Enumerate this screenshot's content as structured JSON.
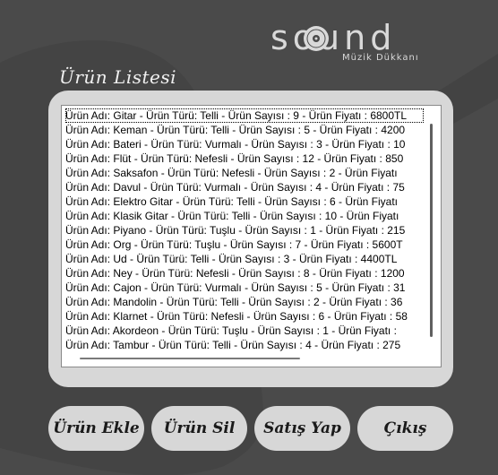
{
  "brand": {
    "name": "sound",
    "tagline": "Müzik Dükkanı"
  },
  "list_title": "Ürün Listesi",
  "products": [
    "Ürün Adı: Gitar - Ürün Türü: Telli - Ürün Sayısı : 9 - Ürün Fiyatı : 6800TL",
    "Ürün Adı: Keman - Ürün Türü: Telli - Ürün Sayısı : 5 - Ürün Fiyatı : 4200",
    "Ürün Adı: Bateri - Ürün Türü: Vurmalı - Ürün Sayısı : 3 - Ürün Fiyatı : 10",
    "Ürün Adı: Flüt - Ürün Türü: Nefesli - Ürün Sayısı : 12 - Ürün Fiyatı : 850",
    "Ürün Adı: Saksafon - Ürün Türü: Nefesli - Ürün Sayısı : 2 - Ürün Fiyatı",
    "Ürün Adı: Davul - Ürün Türü: Vurmalı - Ürün Sayısı : 4 - Ürün Fiyatı : 75",
    "Ürün Adı: Elektro Gitar - Ürün Türü: Telli - Ürün Sayısı : 6 - Ürün Fiyatı",
    "Ürün Adı: Klasik Gitar - Ürün Türü: Telli - Ürün Sayısı : 10 - Ürün Fiyatı",
    "Ürün Adı: Piyano - Ürün Türü: Tuşlu - Ürün Sayısı : 1 - Ürün Fiyatı : 215",
    "Ürün Adı: Org - Ürün Türü: Tuşlu - Ürün Sayısı : 7 - Ürün Fiyatı : 5600T",
    "Ürün Adı: Ud - Ürün Türü: Telli - Ürün Sayısı : 3 - Ürün Fiyatı : 4400TL",
    "Ürün Adı: Ney - Ürün Türü: Nefesli - Ürün Sayısı : 8 - Ürün Fiyatı : 1200",
    "Ürün Adı: Cajon - Ürün Türü: Vurmalı - Ürün Sayısı : 5 - Ürün Fiyatı : 31",
    "Ürün Adı: Mandolin - Ürün Türü: Telli - Ürün Sayısı : 2 - Ürün Fiyatı : 36",
    "Ürün Adı: Klarnet - Ürün Türü: Nefesli - Ürün Sayısı : 6 - Ürün Fiyatı : 58",
    "Ürün Adı: Akordeon - Ürün Türü: Tuşlu - Ürün Sayısı : 1 - Ürün Fiyatı :",
    "Ürün Adı: Tambur - Ürün Türü: Telli - Ürün Sayısı : 4 - Ürün Fiyatı : 275"
  ],
  "buttons": {
    "add": "Ürün Ekle",
    "remove": "Ürün Sil",
    "sell": "Satış Yap",
    "exit": "Çıkış"
  },
  "colors": {
    "background": "#4a4a4a",
    "panel": "#d7d7d7",
    "brand_text": "#d9d9d9"
  }
}
